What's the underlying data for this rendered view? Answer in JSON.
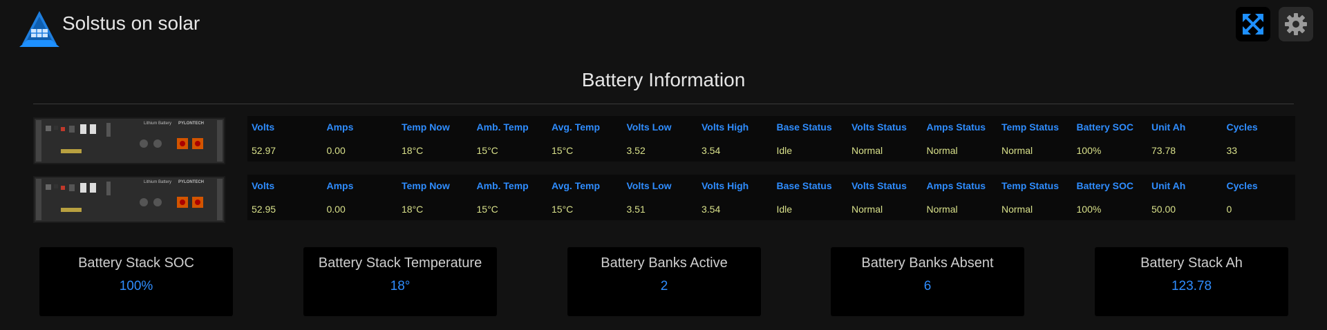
{
  "app": {
    "title": "Solstus on solar",
    "logo_icon": "solar-tent-logo-icon"
  },
  "header": {
    "fullscreen_icon": "fullscreen-icon",
    "settings_icon": "gear-icon",
    "accent": "#1e90ff"
  },
  "section": {
    "title": "Battery Information"
  },
  "columns": [
    "Volts",
    "Amps",
    "Temp Now",
    "Amb. Temp",
    "Avg. Temp",
    "Volts Low",
    "Volts High",
    "Base Status",
    "Volts Status",
    "Amps Status",
    "Temp Status",
    "Battery SOC",
    "Unit Ah",
    "Cycles"
  ],
  "batteries": [
    {
      "image_label": "Lithium Battery",
      "brand": "PYLONTECH",
      "values": [
        "52.97",
        "0.00",
        "18°C",
        "15°C",
        "15°C",
        "3.52",
        "3.54",
        "Idle",
        "Normal",
        "Normal",
        "Normal",
        "100%",
        "73.78",
        "33"
      ]
    },
    {
      "image_label": "Lithium Battery",
      "brand": "PYLONTECH",
      "values": [
        "52.95",
        "0.00",
        "18°C",
        "15°C",
        "15°C",
        "3.51",
        "3.54",
        "Idle",
        "Normal",
        "Normal",
        "Normal",
        "100%",
        "50.00",
        "0"
      ]
    }
  ],
  "summary": [
    {
      "label": "Battery Stack SOC",
      "value": "100%"
    },
    {
      "label": "Battery Stack Temperature",
      "value": "18°"
    },
    {
      "label": "Battery Banks Active",
      "value": "2"
    },
    {
      "label": "Battery Banks Absent",
      "value": "6"
    },
    {
      "label": "Battery Stack Ah",
      "value": "123.78"
    }
  ],
  "colors": {
    "header_text": "#2f8dff",
    "value_text": "#d8e08a",
    "background": "#121212",
    "card_bg": "#000000"
  }
}
